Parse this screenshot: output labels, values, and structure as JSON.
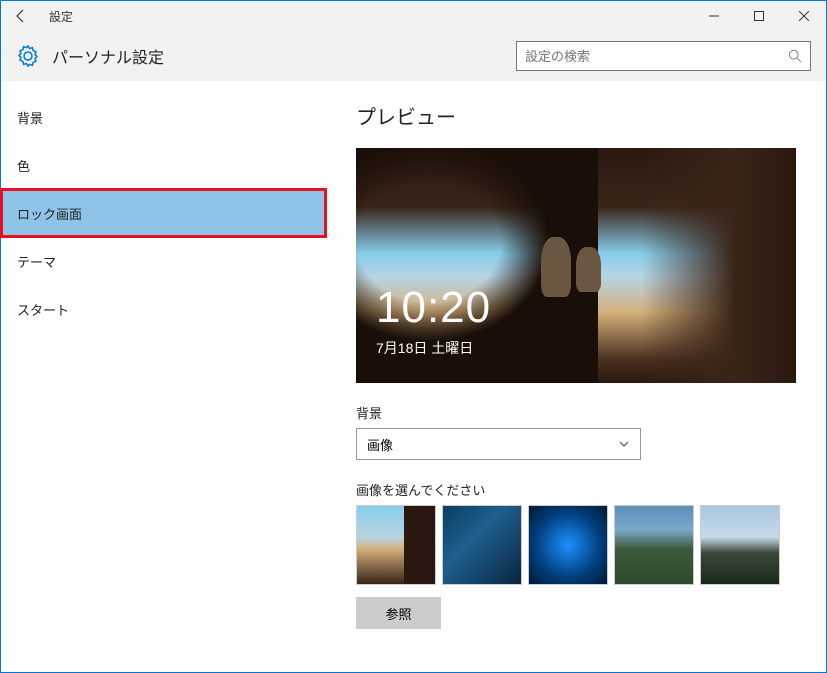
{
  "titlebar": {
    "title": "設定"
  },
  "header": {
    "page_title": "パーソナル設定",
    "search_placeholder": "設定の検索"
  },
  "sidebar": {
    "items": [
      {
        "label": "背景"
      },
      {
        "label": "色"
      },
      {
        "label": "ロック画面",
        "selected": true
      },
      {
        "label": "テーマ"
      },
      {
        "label": "スタート"
      }
    ]
  },
  "content": {
    "preview_title": "プレビュー",
    "lock_time": "10:20",
    "lock_date": "7月18日 土曜日",
    "background_label": "背景",
    "background_select": "画像",
    "choose_image_label": "画像を選んでください",
    "browse_button": "参照"
  }
}
